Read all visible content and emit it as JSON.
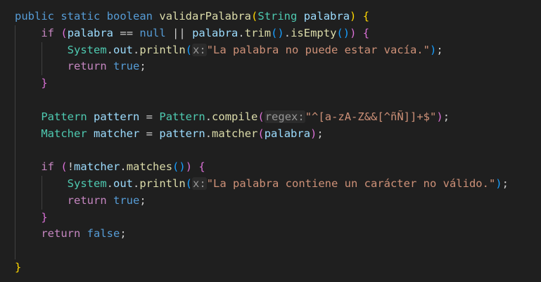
{
  "colors": {
    "background": "#1f1f1f",
    "keyword": "#569cd6",
    "control": "#c586c0",
    "type": "#4ec9b0",
    "function": "#dcdcaa",
    "variable": "#9cdcfe",
    "string": "#ce9178",
    "bracket_level1": "#ffd700",
    "bracket_level2": "#da70d6",
    "bracket_level3": "#179fff"
  },
  "code": {
    "l1": {
      "public": "public",
      "static": "static",
      "boolean": "boolean",
      "method": "validarPalabra",
      "open_paren": "(",
      "param_type": "String",
      "param_name": "palabra",
      "close_paren": ")",
      "open_brace": "{"
    },
    "l2": {
      "if": "if",
      "open_paren": "(",
      "var1": "palabra",
      "op_eq": "==",
      "null": "null",
      "op_or": "||",
      "var2": "palabra",
      "dot1": ".",
      "trim": "trim",
      "trim_parens": "()",
      "dot2": ".",
      "is_empty": "isEmpty",
      "is_empty_parens": "()",
      "close_paren": ")",
      "open_brace": "{"
    },
    "l3": {
      "system": "System",
      "dot1": ".",
      "out": "out",
      "dot2": ".",
      "println": "println",
      "open_paren": "(",
      "hint": "x:",
      "message": "\"La palabra no puede estar vacía.\"",
      "close_paren": ")",
      "semicolon": ";"
    },
    "l4": {
      "return": "return",
      "value": "true",
      "semicolon": ";"
    },
    "l5": {
      "close_brace": "}"
    },
    "l7": {
      "type": "Pattern",
      "var": "pattern",
      "assign": "=",
      "class": "Pattern",
      "dot": ".",
      "compile": "compile",
      "open_paren": "(",
      "hint": "regex:",
      "regex": "\"^[a-zA-Z&&[^ñÑ]]+$\"",
      "close_paren": ")",
      "semicolon": ";"
    },
    "l8": {
      "type": "Matcher",
      "var": "matcher",
      "assign": "=",
      "obj": "pattern",
      "dot": ".",
      "method": "matcher",
      "open_paren": "(",
      "arg": "palabra",
      "close_paren": ")",
      "semicolon": ";"
    },
    "l10": {
      "if": "if",
      "open_paren": "(",
      "not": "!",
      "obj": "matcher",
      "dot": ".",
      "matches": "matches",
      "matches_parens": "()",
      "close_paren": ")",
      "open_brace": "{"
    },
    "l11": {
      "system": "System",
      "dot1": ".",
      "out": "out",
      "dot2": ".",
      "println": "println",
      "open_paren": "(",
      "hint": "x:",
      "message": "\"La palabra contiene un carácter no válido.\"",
      "close_paren": ")",
      "semicolon": ";"
    },
    "l12": {
      "return": "return",
      "value": "true",
      "semicolon": ";"
    },
    "l13": {
      "close_brace": "}"
    },
    "l14": {
      "return": "return",
      "value": "false",
      "semicolon": ";"
    },
    "l16": {
      "close_brace": "}"
    }
  }
}
